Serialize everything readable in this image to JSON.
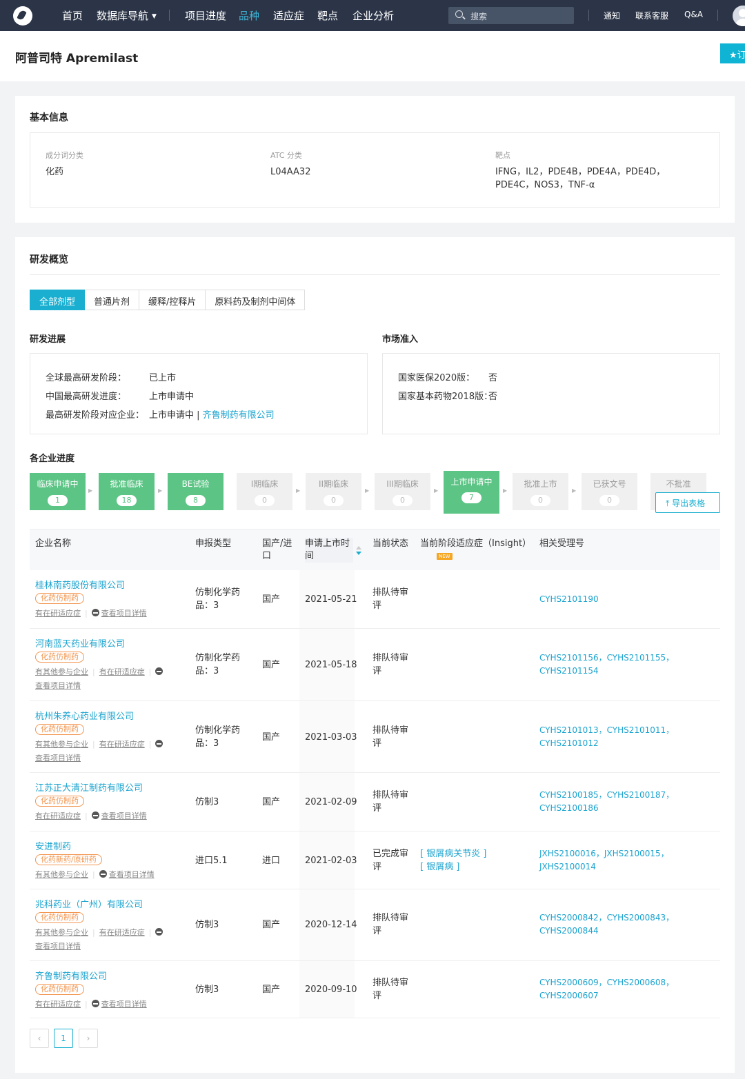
{
  "nav": {
    "items": [
      "首页",
      "数据库导航",
      "项目进度",
      "品种",
      "适应症",
      "靶点",
      "企业分析"
    ],
    "active_index": 3,
    "search_placeholder": "搜索",
    "right_links": [
      "通知",
      "联系客服",
      "Q&A"
    ]
  },
  "page": {
    "title": "阿普司特 Apremilast",
    "subscribe_label": "★订"
  },
  "basic": {
    "heading": "基本信息",
    "fields": [
      {
        "label": "成分词分类",
        "value": "化药"
      },
      {
        "label": "ATC 分类",
        "value": "L04AA32"
      },
      {
        "label": "靶点",
        "value": "IFNG，IL2，PDE4B，PDE4A，PDE4D，PDE4C，NOS3，TNF-α"
      }
    ]
  },
  "overview": {
    "heading": "研发概览",
    "tabs": [
      "全部剂型",
      "普通片剂",
      "缓释/控释片",
      "原料药及制剂中间体"
    ],
    "active_tab": 0,
    "progress": {
      "heading": "研发进展",
      "rows": [
        {
          "k": "全球最高研发阶段：",
          "v": "已上市"
        },
        {
          "k": "中国最高研发进度：",
          "v": "上市申请中"
        },
        {
          "k": "最高研发阶段对应企业：",
          "v": "上市申请中 | ",
          "link": "齐鲁制药有限公司"
        }
      ]
    },
    "market": {
      "heading": "市场准入",
      "rows": [
        {
          "k": "国家医保2020版：",
          "v": "否"
        },
        {
          "k": "国家基本药物2018版：",
          "v": "否"
        }
      ]
    },
    "companies_heading": "各企业进度",
    "stages": [
      {
        "label": "临床申请中",
        "count": "1",
        "active": true
      },
      {
        "label": "批准临床",
        "count": "18",
        "active": true
      },
      {
        "label": "BE试验",
        "count": "8",
        "active": true
      },
      {
        "label": "I期临床",
        "count": "0",
        "active": false
      },
      {
        "label": "II期临床",
        "count": "0",
        "active": false
      },
      {
        "label": "III期临床",
        "count": "0",
        "active": false
      },
      {
        "label": "上市申请中",
        "count": "7",
        "active": true,
        "current": true
      },
      {
        "label": "批准上市",
        "count": "0",
        "active": false
      },
      {
        "label": "已获文号",
        "count": "0",
        "active": false
      },
      {
        "label": "不批准",
        "count": "",
        "active": false
      }
    ],
    "stage_separator": "/",
    "export_label": "导出表格",
    "columns": [
      "企业名称",
      "申报类型",
      "国产/进口",
      "申请上市时间",
      "当前状态",
      "当前阶段适应症（Insight）",
      "相关受理号"
    ],
    "new_badge": "NEW",
    "rows": [
      {
        "company": "桂林南药股份有限公司",
        "tag": "化药仿制药",
        "actions": [
          "有在研适应症",
          "查看项目详情"
        ],
        "type": "仿制化学药品：3",
        "origin": "国产",
        "date": "2021-05-21",
        "status": "排队待审评",
        "indications": [],
        "refs": "CYHS2101190"
      },
      {
        "company": "河南蓝天药业有限公司",
        "tag": "化药仿制药",
        "actions": [
          "有其他参与企业",
          "有在研适应症",
          "查看项目详情"
        ],
        "type": "仿制化学药品：3",
        "origin": "国产",
        "date": "2021-05-18",
        "status": "排队待审评",
        "indications": [],
        "refs": "CYHS2101156，CYHS2101155，CYHS2101154"
      },
      {
        "company": "杭州朱养心药业有限公司",
        "tag": "化药仿制药",
        "actions": [
          "有其他参与企业",
          "有在研适应症",
          "查看项目详情"
        ],
        "type": "仿制化学药品：3",
        "origin": "国产",
        "date": "2021-03-03",
        "status": "排队待审评",
        "indications": [],
        "refs": "CYHS2101013，CYHS2101011，CYHS2101012"
      },
      {
        "company": "江苏正大清江制药有限公司",
        "tag": "化药仿制药",
        "actions": [
          "有在研适应症",
          "查看项目详情"
        ],
        "type": "仿制3",
        "origin": "国产",
        "date": "2021-02-09",
        "status": "排队待审评",
        "indications": [],
        "refs": "CYHS2100185，CYHS2100187，CYHS2100186"
      },
      {
        "company": "安进制药",
        "tag": "化药新药/原研药",
        "actions": [
          "有其他参与企业",
          "查看项目详情"
        ],
        "type": "进口5.1",
        "origin": "进口",
        "date": "2021-02-03",
        "status": "已完成审评",
        "indications": [
          "[ 银屑病关节炎 ]",
          "[ 银屑病 ]"
        ],
        "refs": "JXHS2100016，JXHS2100015，JXHS2100014"
      },
      {
        "company": "兆科药业（广州）有限公司",
        "tag": "化药仿制药",
        "actions": [
          "有其他参与企业",
          "有在研适应症",
          "查看项目详情"
        ],
        "type": "仿制3",
        "origin": "国产",
        "date": "2020-12-14",
        "status": "排队待审评",
        "indications": [],
        "refs": "CYHS2000842，CYHS2000843，CYHS2000844"
      },
      {
        "company": "齐鲁制药有限公司",
        "tag": "化药仿制药",
        "actions": [
          "有在研适应症",
          "查看项目详情"
        ],
        "type": "仿制3",
        "origin": "国产",
        "date": "2020-09-10",
        "status": "排队待审评",
        "indications": [],
        "refs": "CYHS2000609，CYHS2000608，CYHS2000607"
      }
    ],
    "pagination": {
      "prev": "‹",
      "current": "1",
      "next": "›"
    }
  }
}
